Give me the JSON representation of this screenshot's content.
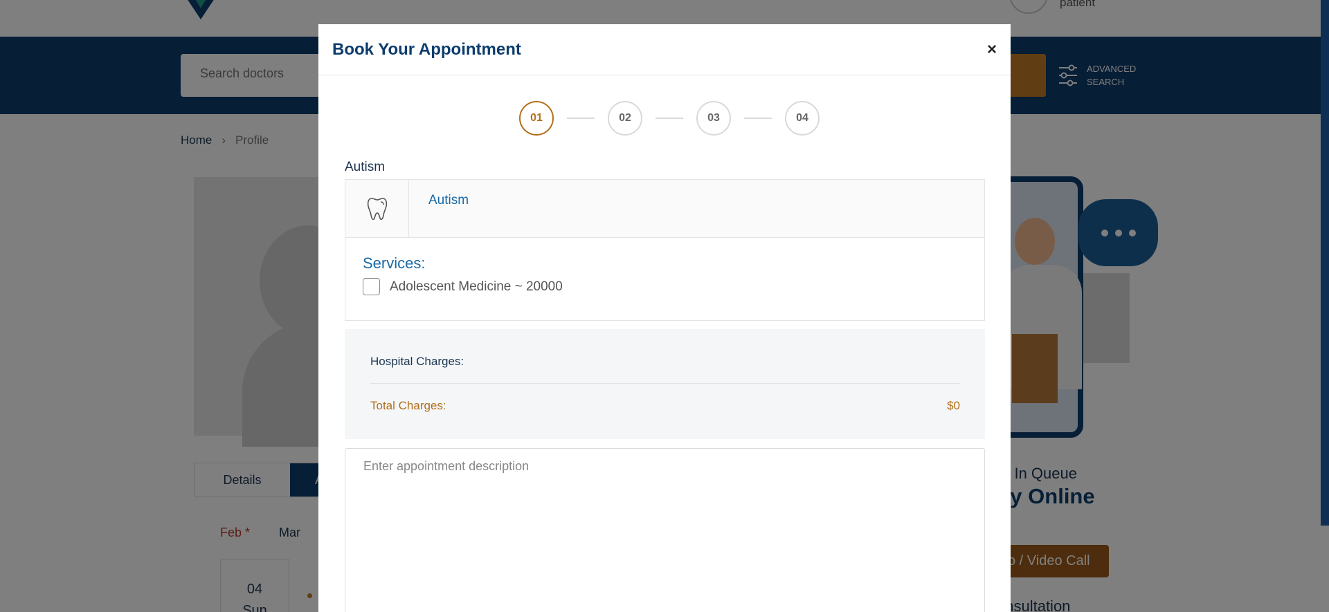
{
  "header": {
    "patient_label": "patient"
  },
  "search": {
    "placeholder": "Search doctors",
    "advanced_label": "ADVANCED SEARCH"
  },
  "breadcrumb": {
    "home": "Home",
    "separator": "›",
    "current": "Profile"
  },
  "profile": {
    "tabs": [
      "Details",
      "A"
    ],
    "months": [
      "Feb *",
      "Mar"
    ],
    "day": {
      "date": "04",
      "weekday": "Sun"
    }
  },
  "promo": {
    "queue_text": "ing In Queue",
    "online_text": "ery Online",
    "video_button": "o / Video Call",
    "consultation_text": "onsultation"
  },
  "modal": {
    "title": "Book Your Appointment",
    "close": "×",
    "steps": [
      {
        "label": "01",
        "active": true
      },
      {
        "label": "02",
        "active": false
      },
      {
        "label": "03",
        "active": false
      },
      {
        "label": "04",
        "active": false
      }
    ],
    "specialty_label": "Autism",
    "specialty_name": "Autism",
    "services_title": "Services:",
    "services": [
      {
        "label": "Adolescent Medicine ~ 20000",
        "checked": false
      }
    ],
    "hospital_charges_label": "Hospital Charges:",
    "hospital_charges_value": "",
    "total_charges_label": "Total Charges:",
    "total_charges_value": "$0",
    "description_placeholder": "Enter appointment description"
  },
  "colors": {
    "primary": "#0d3d6d",
    "accent": "#b36e1a",
    "link": "#1a6aa6"
  }
}
